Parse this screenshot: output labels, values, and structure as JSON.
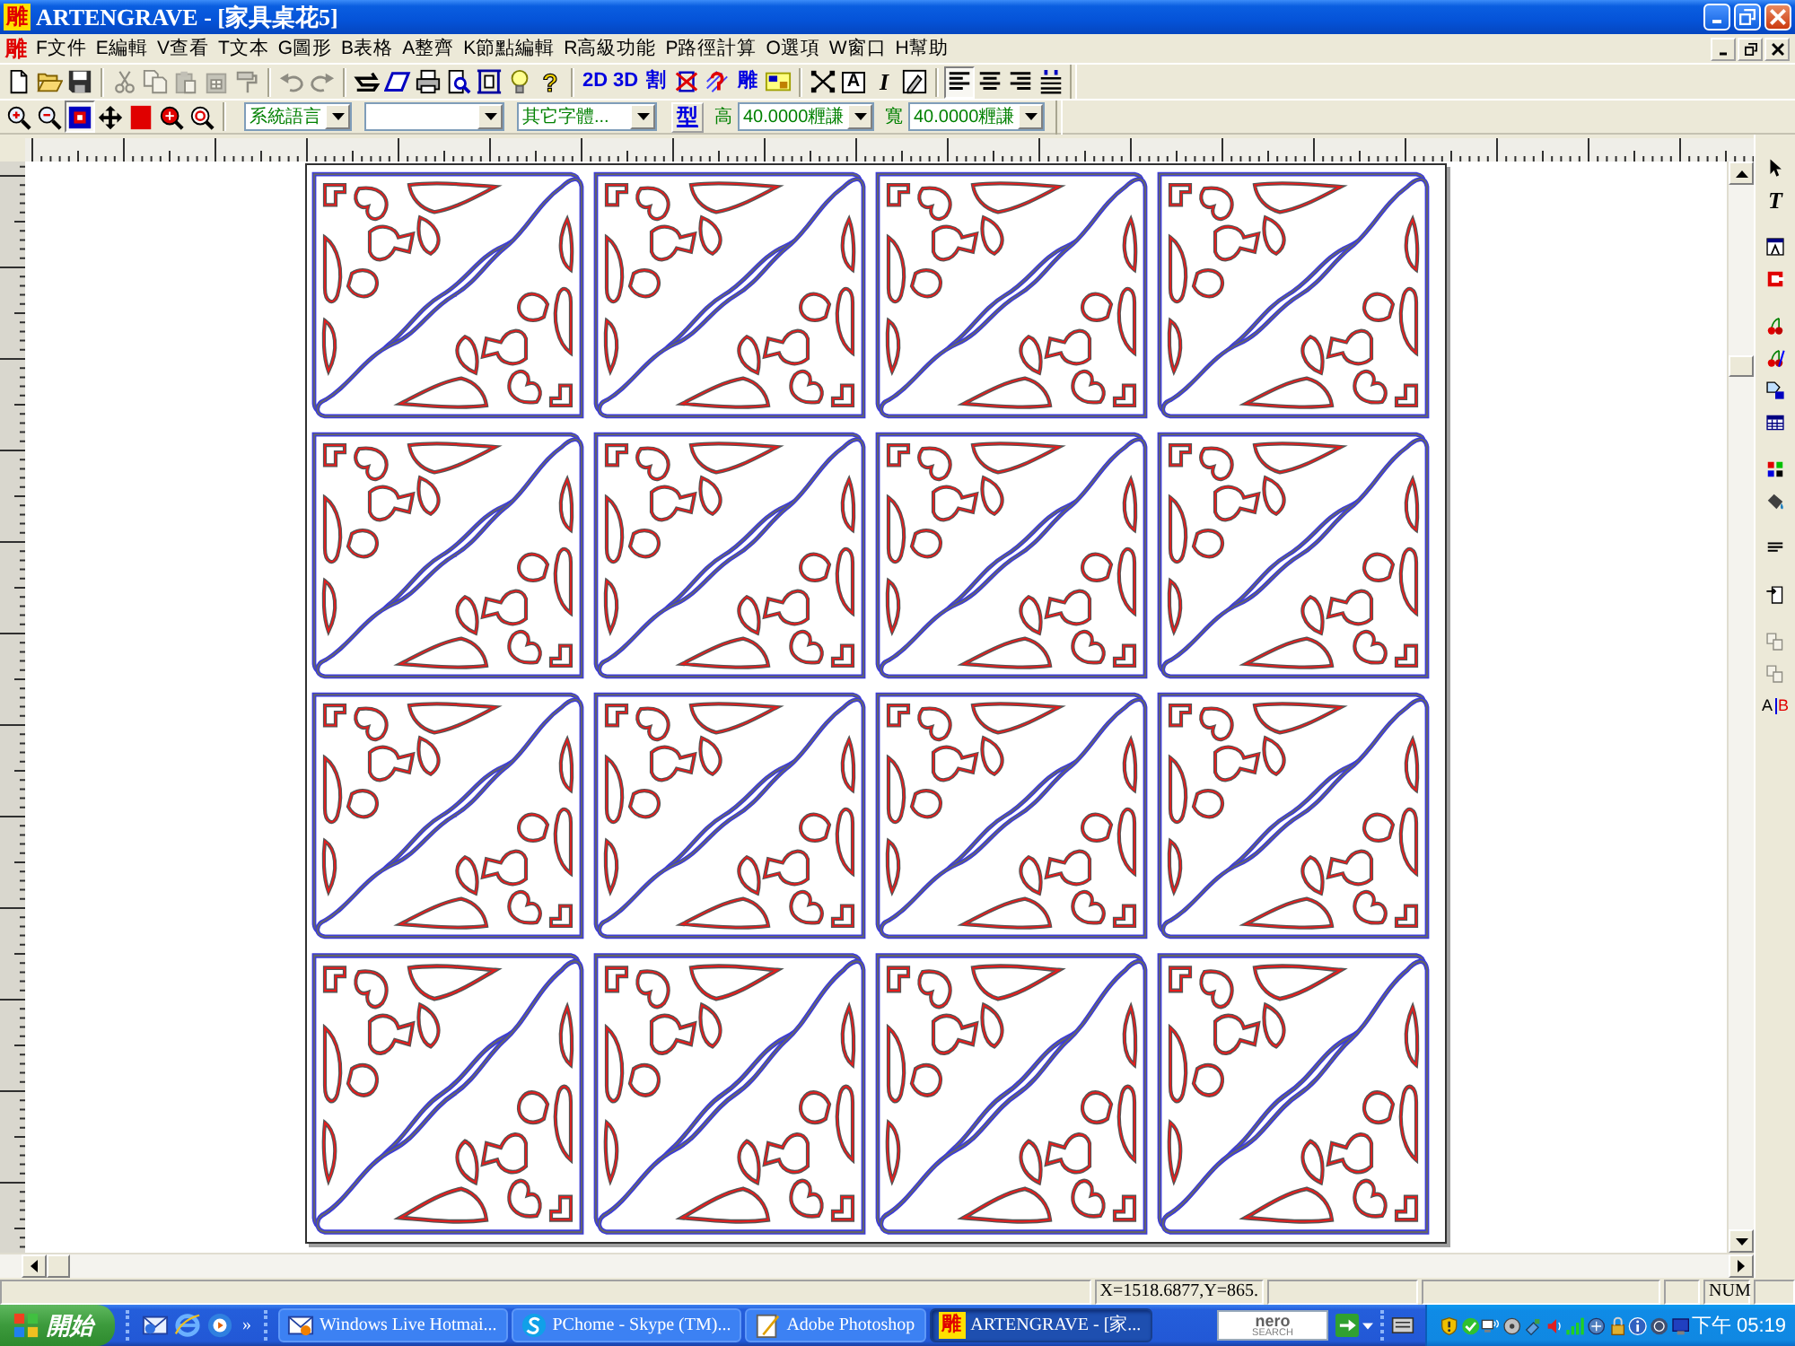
{
  "window": {
    "app_icon": "雕",
    "title": "ARTENGRAVE - [家具桌花5]"
  },
  "menu_bar": {
    "app_icon": "雕",
    "items": [
      "F文件",
      "E編輯",
      "V查看",
      "T文本",
      "G圖形",
      "B表格",
      "A整齊",
      "K節點編輯",
      "R高級功能",
      "P路徑計算",
      "O選項",
      "W窗口",
      "H幫助"
    ]
  },
  "standard_toolbar": {
    "groups": [
      {
        "items": [
          {
            "kind": "new",
            "disabled": false
          },
          {
            "kind": "open",
            "disabled": false
          },
          {
            "kind": "save",
            "disabled": false
          }
        ]
      },
      {
        "items": [
          {
            "kind": "cut",
            "disabled": true
          },
          {
            "kind": "copy",
            "disabled": true
          },
          {
            "kind": "paste",
            "disabled": true
          },
          {
            "kind": "paste_grid",
            "disabled": true
          },
          {
            "kind": "roller",
            "disabled": true
          }
        ]
      },
      {
        "items": [
          {
            "kind": "undo",
            "disabled": true
          },
          {
            "kind": "redo",
            "disabled": true
          }
        ]
      },
      {
        "items": [
          {
            "kind": "zigzag",
            "disabled": false
          },
          {
            "kind": "slant",
            "disabled": false
          },
          {
            "kind": "print",
            "disabled": false
          },
          {
            "kind": "preview",
            "disabled": false
          },
          {
            "kind": "frame",
            "disabled": false
          },
          {
            "kind": "bulb",
            "disabled": false
          },
          {
            "kind": "help",
            "label": "?",
            "disabled": false
          }
        ]
      },
      {
        "items": [
          {
            "kind": "text",
            "label": "2D",
            "disabled": false
          },
          {
            "kind": "text",
            "label": "3D",
            "disabled": false
          },
          {
            "kind": "text",
            "label": "割",
            "disabled": false
          },
          {
            "kind": "crossed",
            "disabled": false
          },
          {
            "kind": "swirl",
            "disabled": false
          },
          {
            "kind": "text",
            "label": "雕",
            "disabled": false
          },
          {
            "kind": "chip",
            "disabled": false
          }
        ]
      },
      {
        "items": [
          {
            "kind": "nodes",
            "disabled": false
          },
          {
            "kind": "boxed_text",
            "label": "A",
            "disabled": false
          },
          {
            "kind": "italic_text",
            "label": "I",
            "disabled": false
          },
          {
            "kind": "pencil_box",
            "disabled": false
          }
        ]
      }
    ]
  },
  "align_buttons": [
    {
      "kind": "left",
      "selected": true
    },
    {
      "kind": "center",
      "selected": false
    },
    {
      "kind": "right",
      "selected": false
    },
    {
      "kind": "justify",
      "selected": false
    }
  ],
  "view_toolbar": {
    "tools": [
      {
        "kind": "zoom_in",
        "selected": false
      },
      {
        "kind": "zoom_out",
        "selected": false
      },
      {
        "kind": "zoom_page",
        "selected": true
      },
      {
        "kind": "pan",
        "selected": false
      },
      {
        "kind": "solid_square",
        "selected": false
      },
      {
        "kind": "zoom_fill",
        "selected": false
      },
      {
        "kind": "zoom_ring",
        "selected": false
      }
    ],
    "language": "系統語言",
    "font": "其它字體...",
    "type_button": "型",
    "height_label": "高",
    "height": "40.0000糎謙",
    "width_label": "寬",
    "width": "40.0000糎謙"
  },
  "toolbox": {
    "groups": [
      {
        "items": [
          {
            "kind": "pointer",
            "disabled": false
          },
          {
            "kind": "serif_text",
            "label": "T",
            "disabled": false
          }
        ]
      },
      {
        "items": [
          {
            "kind": "window_arrow",
            "disabled": false
          },
          {
            "kind": "bracket",
            "disabled": false
          }
        ]
      },
      {
        "items": [
          {
            "kind": "cherries",
            "disabled": false
          },
          {
            "kind": "cherries_pen",
            "disabled": false
          },
          {
            "kind": "shape",
            "disabled": false
          },
          {
            "kind": "table",
            "disabled": false
          }
        ]
      },
      {
        "items": [
          {
            "kind": "squares",
            "disabled": false
          },
          {
            "kind": "bucket",
            "disabled": false
          }
        ]
      },
      {
        "items": [
          {
            "kind": "lines",
            "disabled": false
          }
        ]
      },
      {
        "items": [
          {
            "kind": "page_arrow",
            "disabled": false
          }
        ]
      },
      {
        "items": [
          {
            "kind": "copies",
            "disabled": true
          },
          {
            "kind": "copies",
            "disabled": true
          },
          {
            "kind": "split_text",
            "labels": [
              "A",
              "B"
            ],
            "disabled": false
          }
        ]
      }
    ]
  },
  "status_bar": {
    "coordinates": "X=1518.6877,Y=865.",
    "num_lock": "NUM"
  },
  "taskbar": {
    "start": "開始",
    "quick_launch_more": "»",
    "tasks": [
      {
        "kind": "mail",
        "label": "Windows Live Hotmai...",
        "selected": false
      },
      {
        "kind": "chat",
        "label": "PChome - Skype (TM)...",
        "selected": false
      },
      {
        "kind": "feather",
        "label": "Adobe Photoshop",
        "selected": false
      },
      {
        "kind": "app",
        "icon_text": "雕",
        "label": "ARTENGRAVE - [家...",
        "selected": true
      }
    ],
    "search_logo": "nero",
    "search_logo_sub": "SEARCH",
    "clock": "下午 05:19"
  }
}
